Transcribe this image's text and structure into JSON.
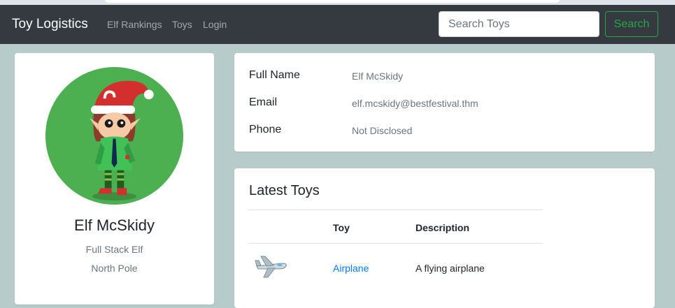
{
  "navbar": {
    "brand": "Toy Logistics",
    "links": [
      "Elf Rankings",
      "Toys",
      "Login"
    ],
    "search_placeholder": "Search Toys",
    "search_button": "Search",
    "search_button_color": "#28a745",
    "background": "#343a40"
  },
  "profile": {
    "avatar_icon": "elf-avatar-icon",
    "avatar_bg": "#4caf50",
    "name": "Elf McSkidy",
    "role": "Full Stack Elf",
    "location": "North Pole"
  },
  "info": {
    "rows": [
      {
        "label": "Full Name",
        "value": "Elf McSkidy"
      },
      {
        "label": "Email",
        "value": "elf.mcskidy@bestfestival.thm"
      },
      {
        "label": "Phone",
        "value": "Not Disclosed"
      }
    ]
  },
  "toys": {
    "title": "Latest Toys",
    "columns": [
      "",
      "Toy",
      "Description"
    ],
    "rows": [
      {
        "image_icon": "airplane-icon",
        "name": "Airplane",
        "description": "A flying airplane"
      }
    ]
  }
}
